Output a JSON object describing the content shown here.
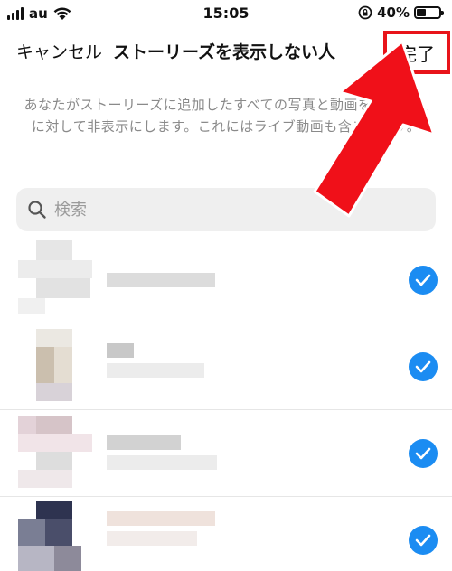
{
  "status": {
    "carrier": "au",
    "time": "15:05",
    "battery": "40%",
    "battery_level": 0.4
  },
  "nav": {
    "cancel_label": "キャンセル",
    "title": "ストーリーズを表示しない人",
    "done_label": "完了"
  },
  "description": "あなたがストーリーズに追加したすべての写真と動画を特定の人に対して非表示にします。これにはライブ動画も含まれます。",
  "search": {
    "placeholder": "検索"
  },
  "users": [
    {
      "checked": true
    },
    {
      "checked": true
    },
    {
      "checked": true
    },
    {
      "checked": true
    }
  ],
  "colors": {
    "accent": "#1b8cf2",
    "highlight": "#e8141a"
  }
}
